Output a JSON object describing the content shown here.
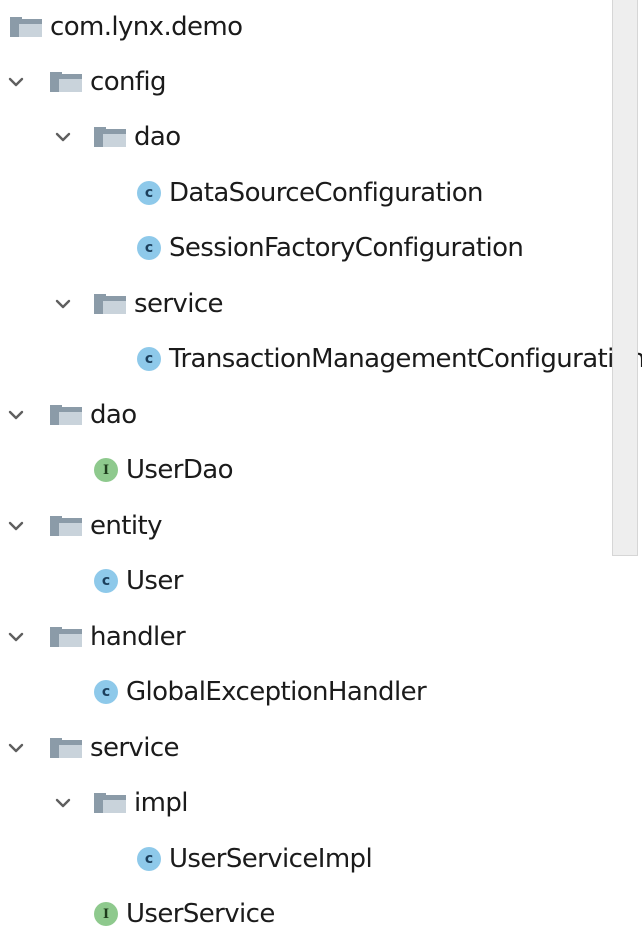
{
  "tree": [
    {
      "label": "com.lynx.demo",
      "icon": "package-icon",
      "depth": 0,
      "expandable": false,
      "expanded": false
    },
    {
      "label": "config",
      "icon": "package-icon",
      "depth": 1,
      "expandable": true,
      "expanded": true
    },
    {
      "label": "dao",
      "icon": "package-icon",
      "depth": 2,
      "expandable": true,
      "expanded": true
    },
    {
      "label": "DataSourceConfiguration",
      "icon": "class-icon",
      "badge": "c",
      "depth": 3,
      "expandable": false,
      "expanded": false
    },
    {
      "label": "SessionFactoryConfiguration",
      "icon": "class-icon",
      "badge": "c",
      "depth": 3,
      "expandable": false,
      "expanded": false
    },
    {
      "label": "service",
      "icon": "package-icon",
      "depth": 2,
      "expandable": true,
      "expanded": true
    },
    {
      "label": "TransactionManagementConfiguration",
      "icon": "class-icon",
      "badge": "c",
      "depth": 3,
      "expandable": false,
      "expanded": false
    },
    {
      "label": "dao",
      "icon": "package-icon",
      "depth": 1,
      "expandable": true,
      "expanded": true
    },
    {
      "label": "UserDao",
      "icon": "interface-icon",
      "badge": "I",
      "depth": 2,
      "expandable": false,
      "expanded": false
    },
    {
      "label": "entity",
      "icon": "package-icon",
      "depth": 1,
      "expandable": true,
      "expanded": true
    },
    {
      "label": "User",
      "icon": "class-icon",
      "badge": "c",
      "depth": 2,
      "expandable": false,
      "expanded": false
    },
    {
      "label": "handler",
      "icon": "package-icon",
      "depth": 1,
      "expandable": true,
      "expanded": true
    },
    {
      "label": "GlobalExceptionHandler",
      "icon": "class-icon",
      "badge": "c",
      "depth": 2,
      "expandable": false,
      "expanded": false
    },
    {
      "label": "service",
      "icon": "package-icon",
      "depth": 1,
      "expandable": true,
      "expanded": true
    },
    {
      "label": "impl",
      "icon": "package-icon",
      "depth": 2,
      "expandable": true,
      "expanded": true
    },
    {
      "label": "UserServiceImpl",
      "icon": "class-icon",
      "badge": "c",
      "depth": 3,
      "expandable": false,
      "expanded": false
    },
    {
      "label": "UserService",
      "icon": "interface-icon",
      "badge": "I",
      "depth": 2,
      "expandable": false,
      "expanded": false
    }
  ],
  "colors": {
    "folder_body": "#8b9ba8",
    "folder_highlight": "#c9d3db",
    "chevron": "#5f5f5f",
    "class_badge": "#8ec9ea",
    "interface_badge": "#8ec98d",
    "text": "#1b1b1b",
    "scrollbar_track": "#eeeeee"
  }
}
